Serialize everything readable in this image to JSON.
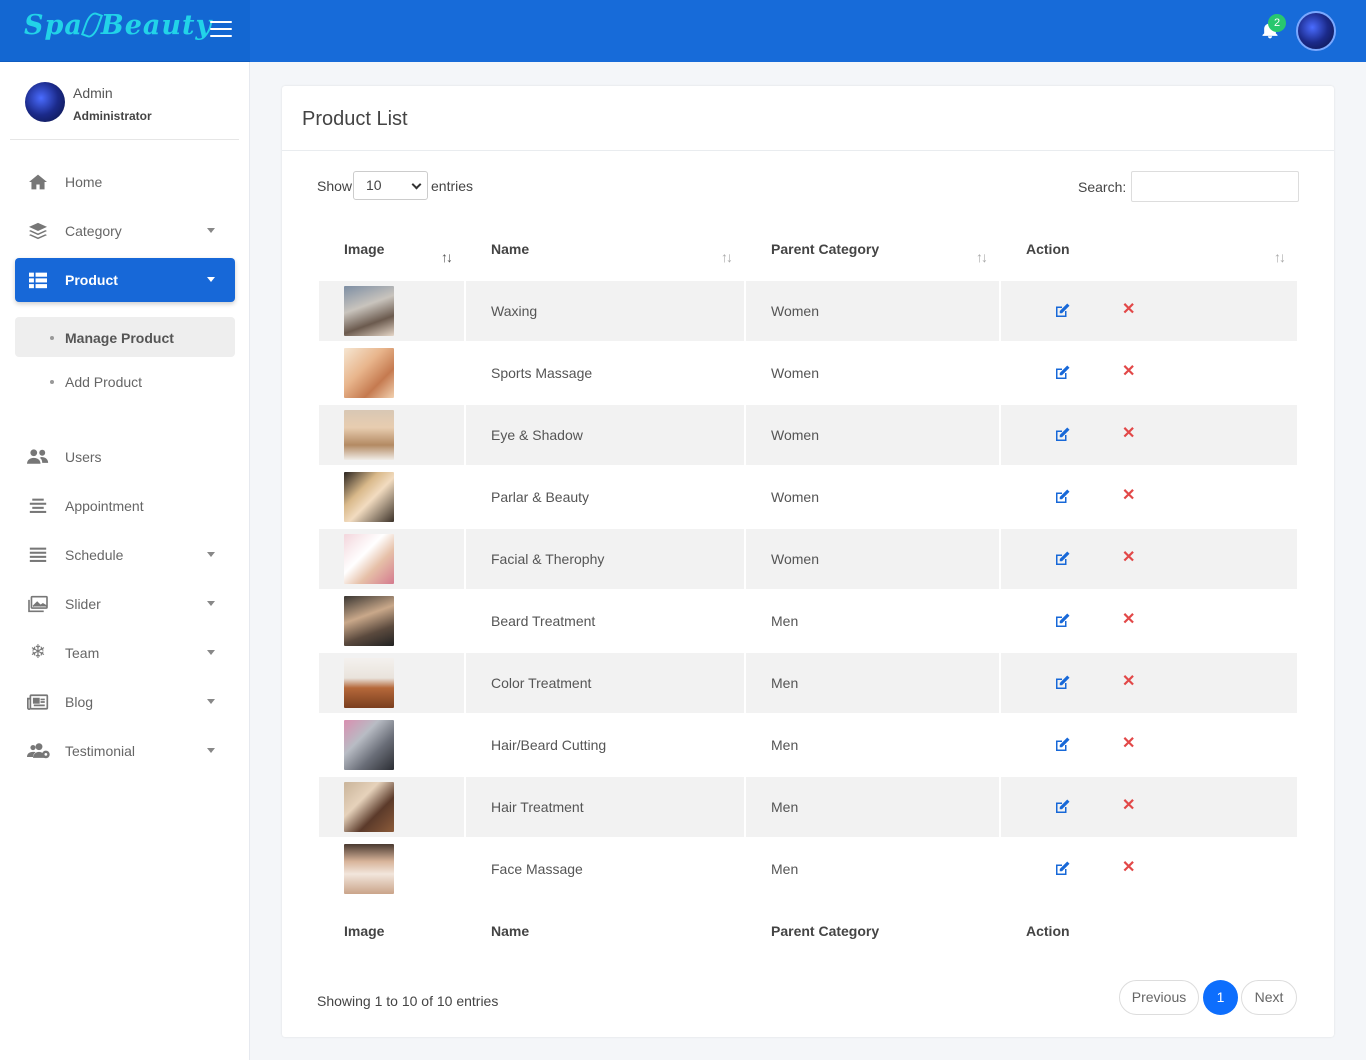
{
  "brand": {
    "logo_left": "Spa",
    "logo_right": "Beauty"
  },
  "header": {
    "notification_count": "2"
  },
  "user": {
    "name": "Admin",
    "role": "Administrator"
  },
  "sidebar": {
    "items": [
      {
        "label": "Home",
        "icon": "home-icon"
      },
      {
        "label": "Category",
        "icon": "layers-icon"
      },
      {
        "label": "Product",
        "icon": "grid-list-icon"
      },
      {
        "label": "Users",
        "icon": "users-icon"
      },
      {
        "label": "Appointment",
        "icon": "align-center-icon"
      },
      {
        "label": "Schedule",
        "icon": "list-icon"
      },
      {
        "label": "Slider",
        "icon": "images-icon"
      },
      {
        "label": "Team",
        "icon": "snowflake-icon"
      },
      {
        "label": "Blog",
        "icon": "newspaper-icon"
      },
      {
        "label": "Testimonial",
        "icon": "users-cog-icon"
      }
    ],
    "product_sub": [
      {
        "label": "Manage Product"
      },
      {
        "label": "Add Product"
      }
    ]
  },
  "card": {
    "title": "Product List",
    "show_label": "Show",
    "entries_value": "10",
    "entries_label": "entries",
    "search_label": "Search:",
    "search_value": ""
  },
  "table": {
    "headers": [
      "Image",
      "Name",
      "Parent Category",
      "Action"
    ],
    "rows": [
      {
        "name": "Waxing",
        "parent": "Women"
      },
      {
        "name": "Sports Massage",
        "parent": "Women"
      },
      {
        "name": "Eye & Shadow",
        "parent": "Women"
      },
      {
        "name": "Parlar & Beauty",
        "parent": "Women"
      },
      {
        "name": "Facial & Therophy",
        "parent": "Women"
      },
      {
        "name": "Beard Treatment",
        "parent": "Men"
      },
      {
        "name": "Color Treatment",
        "parent": "Men"
      },
      {
        "name": "Hair/Beard Cutting",
        "parent": "Men"
      },
      {
        "name": "Hair Treatment",
        "parent": "Men"
      },
      {
        "name": "Face Massage",
        "parent": "Men"
      }
    ]
  },
  "pagination": {
    "info": "Showing 1 to 10 of 10 entries",
    "previous": "Previous",
    "current": "1",
    "next": "Next"
  },
  "colors": {
    "topbar": "#176bd9",
    "active_nav": "#1768d8",
    "edit_icon": "#1768d8",
    "delete_icon": "#e24848",
    "page_active": "#0d6efd",
    "badge": "#28c76f"
  }
}
